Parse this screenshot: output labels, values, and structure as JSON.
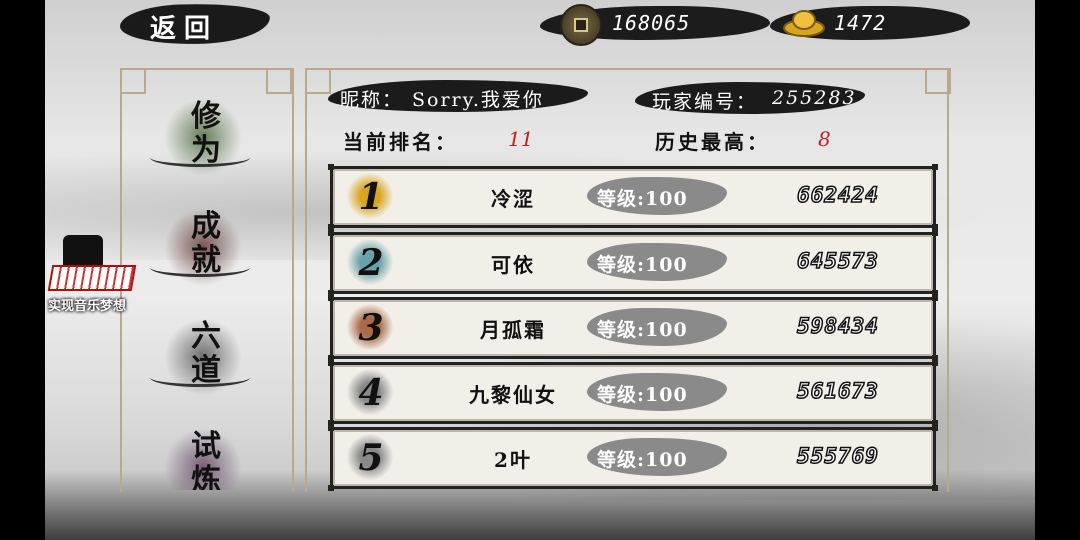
{
  "topbar": {
    "back_label": "返回",
    "copper_coins": "168065",
    "gold_ingots": "1472",
    "icons": {
      "coin": "copper-coin-icon",
      "ingot": "gold-ingot-icon"
    }
  },
  "sidebar": {
    "tabs": [
      {
        "label": "修为",
        "color": "#4f6b3c"
      },
      {
        "label": "成就",
        "color": "#6b3c3c"
      },
      {
        "label": "六道",
        "color": "#5a5a5a"
      },
      {
        "label": "试炼",
        "color": "#6a4a6b"
      }
    ]
  },
  "overlay": {
    "music_caption": "实现音乐梦想"
  },
  "player": {
    "nickname_label": "昵称：",
    "nickname": "Sorry.我爱你",
    "id_label": "玩家编号：",
    "id": "255283",
    "current_rank_label": "当前排名：",
    "current_rank": "11",
    "best_rank_label": "历史最高：",
    "best_rank": "8"
  },
  "leaderboard": {
    "rows": [
      {
        "rank": "1",
        "name": "冷涩",
        "level": "等级:100",
        "score": "662424",
        "badge_color": "#d9a520"
      },
      {
        "rank": "2",
        "name": "可依",
        "level": "等级:100",
        "score": "645573",
        "badge_color": "#6aa0a8"
      },
      {
        "rank": "3",
        "name": "月孤霜",
        "level": "等级:100",
        "score": "598434",
        "badge_color": "#a86a4a"
      },
      {
        "rank": "4",
        "name": "九黎仙女",
        "level": "等级:100",
        "score": "561673",
        "badge_color": "#8a8a8a"
      },
      {
        "rank": "5",
        "name": "2叶",
        "level": "等级:100",
        "score": "555769",
        "badge_color": "#8a8a8a"
      }
    ]
  }
}
